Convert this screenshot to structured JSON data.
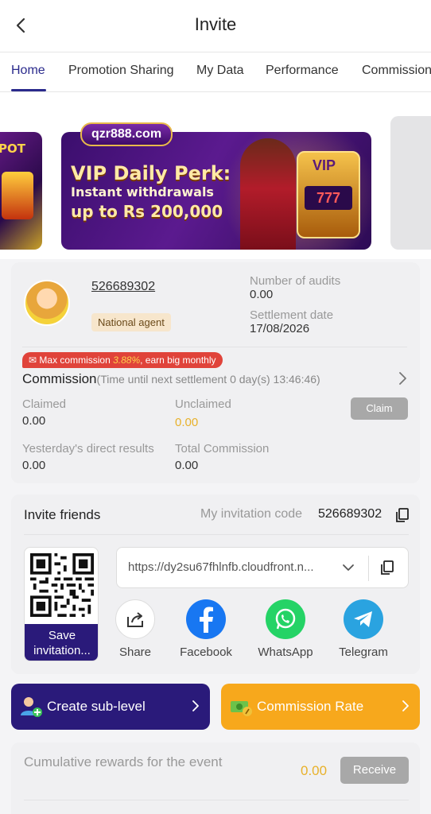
{
  "header": {
    "title": "Invite",
    "back_icon": "chevron-left-icon"
  },
  "tabs": [
    {
      "label": "Home",
      "active": true
    },
    {
      "label": "Promotion Sharing"
    },
    {
      "label": "My Data"
    },
    {
      "label": "Performance"
    },
    {
      "label": "Commission"
    }
  ],
  "banner": {
    "left_text": "POT",
    "brand": "qzr888.com",
    "headline": "VIP Daily Perk:",
    "subline": "Instant withdrawals",
    "amount": "up to Rs 200,000",
    "vip": "VIP",
    "sevens": "777"
  },
  "agent": {
    "id": "526689302",
    "badge": "National agent",
    "audits_label": "Number of audits",
    "audits_value": "0.00",
    "settlement_label": "Settlement date",
    "settlement_value": "17/08/2026"
  },
  "commission": {
    "promo_prefix": "Max commission ",
    "promo_rate": "3.88%",
    "promo_suffix": ", earn big monthly",
    "title": "Commission",
    "sub": "(Time until next settlement  0 day(s) 13:46:46)",
    "claimed_label": "Claimed",
    "claimed_value": "0.00",
    "unclaimed_label": "Unclaimed",
    "unclaimed_value": "0.00",
    "claim_button": "Claim",
    "yesterday_label": "Yesterday's direct results",
    "yesterday_value": "0.00",
    "total_label": "Total Commission",
    "total_value": "0.00"
  },
  "invite": {
    "title": "Invite friends",
    "code_label": "My invitation code",
    "code_value": "526689302",
    "save_label": "Save invitation...",
    "url": "https://dy2su67fhlnfb.cloudfront.n...",
    "share": [
      {
        "label": "Share",
        "icon": "share-icon",
        "color": "#ffffff"
      },
      {
        "label": "Facebook",
        "icon": "facebook-icon",
        "color": "#1877f2"
      },
      {
        "label": "WhatsApp",
        "icon": "whatsapp-icon",
        "color": "#25d366"
      },
      {
        "label": "Telegram",
        "icon": "telegram-icon",
        "color": "#2aa3e0"
      }
    ]
  },
  "actions": {
    "create_sub": "Create sub-level",
    "commission_rate": "Commission Rate"
  },
  "rewards": {
    "label": "Cumulative rewards for the event",
    "value": "0.00",
    "receive": "Receive"
  },
  "colors": {
    "accent": "#2a1a7a",
    "gold": "#e8b12a",
    "orange": "#f7a81c",
    "badge_red": "#e0433a"
  }
}
